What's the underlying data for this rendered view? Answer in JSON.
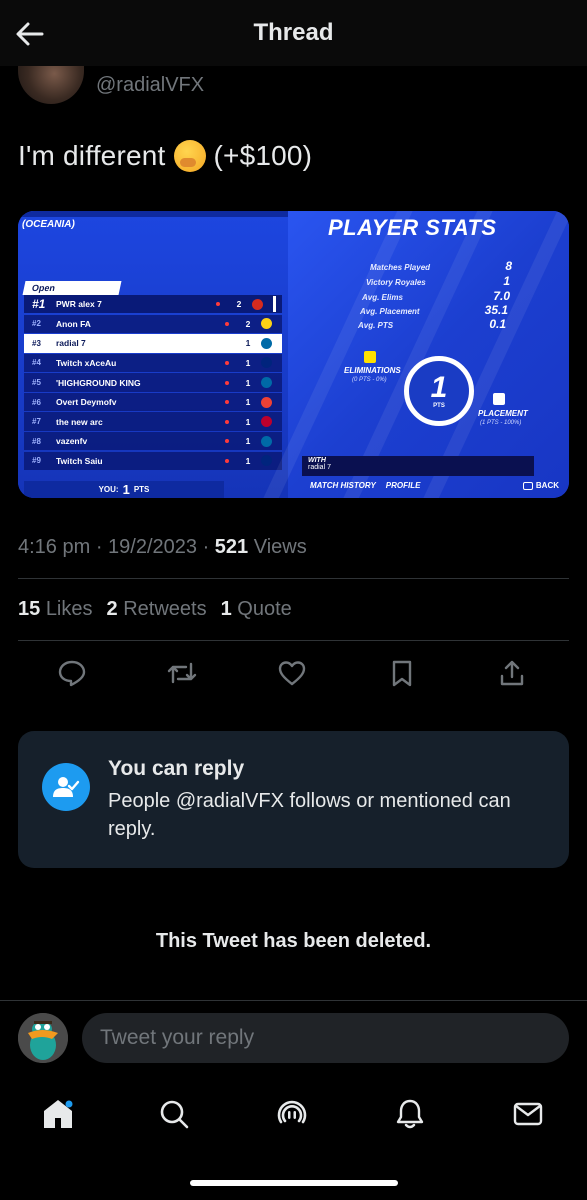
{
  "header": {
    "title": "Thread"
  },
  "tweet": {
    "handle": "@radialVFX",
    "text_before": "I'm different",
    "text_after": "(+$100)",
    "timestamp": "4:16 pm · 19/2/2023 · ",
    "views_count": "521",
    "views_label": " Views",
    "likes_count": "15",
    "likes_label": "Likes",
    "retweets_count": "2",
    "retweets_label": "Retweets",
    "quotes_count": "1",
    "quotes_label": "Quote"
  },
  "game": {
    "region": "(OCEANIA)",
    "open_label": "Open",
    "leaderboard": [
      {
        "rank": "#1",
        "name": "PWR alex 7",
        "pts": "2",
        "flag": "#d52b1e"
      },
      {
        "rank": "#2",
        "name": "Anon FA",
        "pts": "2",
        "flag": "#fcd116"
      },
      {
        "rank": "#3",
        "name": "radial 7",
        "pts": "1",
        "flag": "#006aa7"
      },
      {
        "rank": "#4",
        "name": "Twitch xAceAu",
        "pts": "1",
        "flag": "#00247d"
      },
      {
        "rank": "#5",
        "name": "'HIGHGROUND KING",
        "pts": "1",
        "flag": "#006aa7"
      },
      {
        "rank": "#6",
        "name": "Overt Deymofv",
        "pts": "1",
        "flag": "#ef4135"
      },
      {
        "rank": "#7",
        "name": "the new arc",
        "pts": "1",
        "flag": "#bc002d"
      },
      {
        "rank": "#8",
        "name": "vazenfv",
        "pts": "1",
        "flag": "#006aa7"
      },
      {
        "rank": "#9",
        "name": "Twitch Saiu",
        "pts": "1",
        "flag": "#00247d"
      }
    ],
    "you_label": "YOU:",
    "you_pts": "1",
    "pts_unit": "PTS",
    "player_stats_title": "PLAYER STATS",
    "stats": [
      {
        "label": "Matches Played",
        "value": "8"
      },
      {
        "label": "Victory Royales",
        "value": "1"
      },
      {
        "label": "Avg. Elims",
        "value": "7.0"
      },
      {
        "label": "Avg. Placement",
        "value": "35.1"
      },
      {
        "label": "Avg. PTS",
        "value": "0.1"
      }
    ],
    "eliminations_label": "ELIMINATIONS",
    "eliminations_sub": "(0 PTS - 0%)",
    "total_pts": "1",
    "placement_label": "PLACEMENT",
    "placement_sub": "(1 PTS - 100%)",
    "with_label": "WITH",
    "with_name": "radial 7",
    "link_match_history": "MATCH HISTORY",
    "link_profile": "PROFILE",
    "back_label": "BACK"
  },
  "reply_card": {
    "title": "You can reply",
    "body": "People @radialVFX follows or mentioned can reply."
  },
  "deleted_notice": "This Tweet has been deleted.",
  "compose": {
    "placeholder": "Tweet your reply"
  },
  "icons": {
    "back": "arrow-left-icon",
    "reply": "comment-icon",
    "retweet": "retweet-icon",
    "like": "heart-icon",
    "bookmark": "bookmark-icon",
    "share": "share-icon",
    "home": "home-icon",
    "search": "search-icon",
    "spaces": "spaces-icon",
    "notifications": "bell-icon",
    "messages": "mail-icon"
  },
  "colors": {
    "accent": "#1d9bf0",
    "background": "#000000",
    "card": "#16202b",
    "muted": "#71767b"
  }
}
